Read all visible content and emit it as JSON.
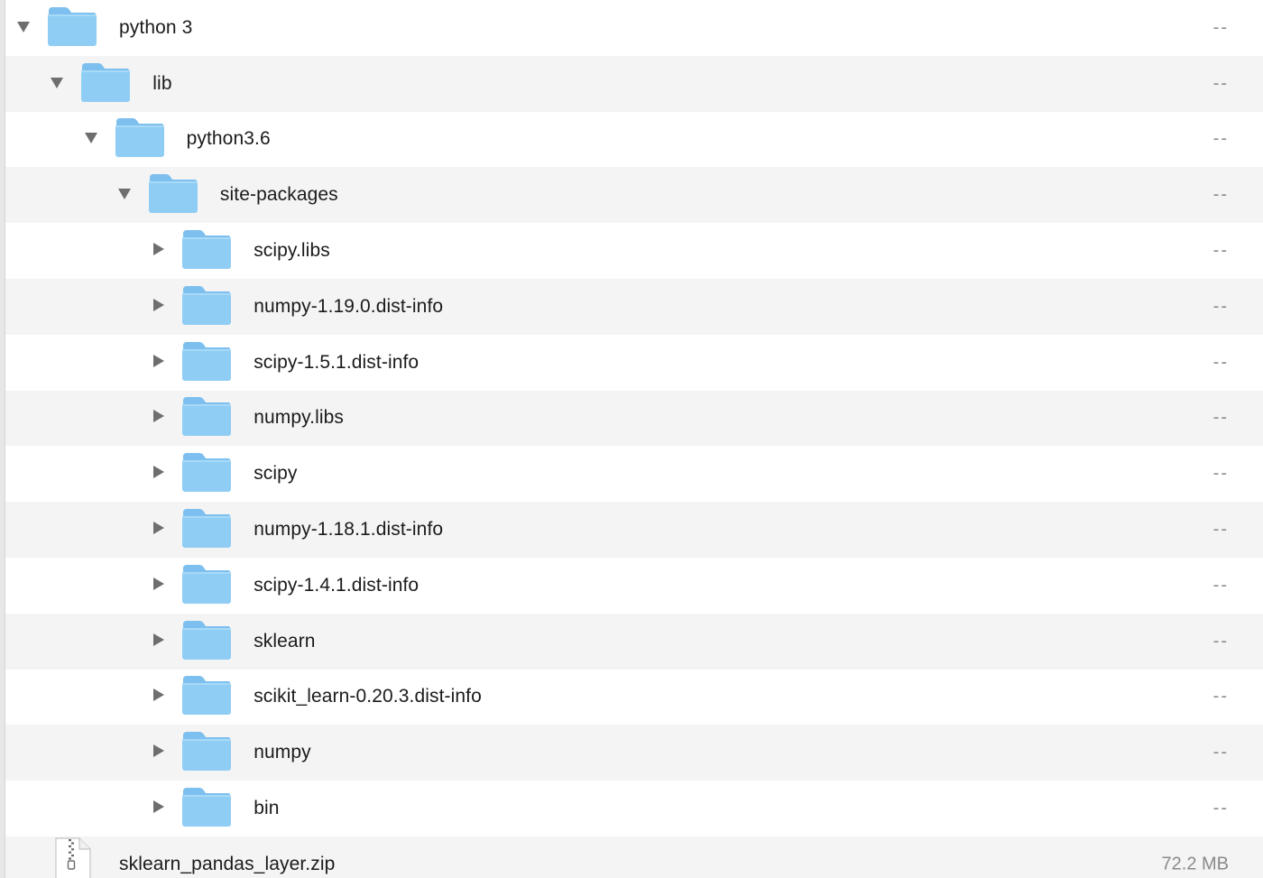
{
  "rows": [
    {
      "name": "python 3",
      "size": "--",
      "kind": "folder",
      "expanded": true,
      "level": 0,
      "icon": "folder-icon"
    },
    {
      "name": "lib",
      "size": "--",
      "kind": "folder",
      "expanded": true,
      "level": 1,
      "icon": "folder-icon"
    },
    {
      "name": "python3.6",
      "size": "--",
      "kind": "folder",
      "expanded": true,
      "level": 2,
      "icon": "folder-icon"
    },
    {
      "name": "site-packages",
      "size": "--",
      "kind": "folder",
      "expanded": true,
      "level": 3,
      "icon": "folder-icon"
    },
    {
      "name": "scipy.libs",
      "size": "--",
      "kind": "folder",
      "expanded": false,
      "level": 4,
      "icon": "folder-icon"
    },
    {
      "name": "numpy-1.19.0.dist-info",
      "size": "--",
      "kind": "folder",
      "expanded": false,
      "level": 4,
      "icon": "folder-icon"
    },
    {
      "name": "scipy-1.5.1.dist-info",
      "size": "--",
      "kind": "folder",
      "expanded": false,
      "level": 4,
      "icon": "folder-icon"
    },
    {
      "name": "numpy.libs",
      "size": "--",
      "kind": "folder",
      "expanded": false,
      "level": 4,
      "icon": "folder-icon"
    },
    {
      "name": "scipy",
      "size": "--",
      "kind": "folder",
      "expanded": false,
      "level": 4,
      "icon": "folder-icon"
    },
    {
      "name": "numpy-1.18.1.dist-info",
      "size": "--",
      "kind": "folder",
      "expanded": false,
      "level": 4,
      "icon": "folder-icon"
    },
    {
      "name": "scipy-1.4.1.dist-info",
      "size": "--",
      "kind": "folder",
      "expanded": false,
      "level": 4,
      "icon": "folder-icon"
    },
    {
      "name": "sklearn",
      "size": "--",
      "kind": "folder",
      "expanded": false,
      "level": 4,
      "icon": "folder-icon"
    },
    {
      "name": "scikit_learn-0.20.3.dist-info",
      "size": "--",
      "kind": "folder",
      "expanded": false,
      "level": 4,
      "icon": "folder-icon"
    },
    {
      "name": "numpy",
      "size": "--",
      "kind": "folder",
      "expanded": false,
      "level": 4,
      "icon": "folder-icon"
    },
    {
      "name": "bin",
      "size": "--",
      "kind": "folder",
      "expanded": false,
      "level": 4,
      "icon": "folder-icon"
    },
    {
      "name": "sklearn_pandas_layer.zip",
      "size": "72.2 MB",
      "kind": "zip",
      "level": 0,
      "icon": "zip-file-icon",
      "icon_label": "ZIP"
    }
  ],
  "colors": {
    "folder_body": "#8fcdf4",
    "folder_tab": "#7dbfee",
    "row_alt": "#f4f4f4",
    "text": "#1b1b1b",
    "size_text": "#8a8a8a",
    "disclosure": "#6e6e6e"
  }
}
